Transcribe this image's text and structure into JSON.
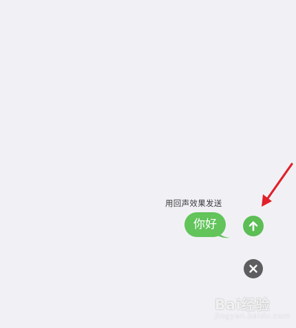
{
  "compose": {
    "effect_label": "用回声效果发送",
    "message_text": "你好"
  },
  "controls": {
    "send_icon": "arrow-up-icon",
    "close_icon": "close-icon"
  },
  "watermark": {
    "brand": "Bai经验",
    "url": "jingyan.baidu.com"
  },
  "colors": {
    "background": "#f1f1f5",
    "bubble": "#62c45b",
    "send_button": "#5cbe55",
    "close_button": "#5e5e61",
    "annotation_arrow": "#e0202a"
  }
}
